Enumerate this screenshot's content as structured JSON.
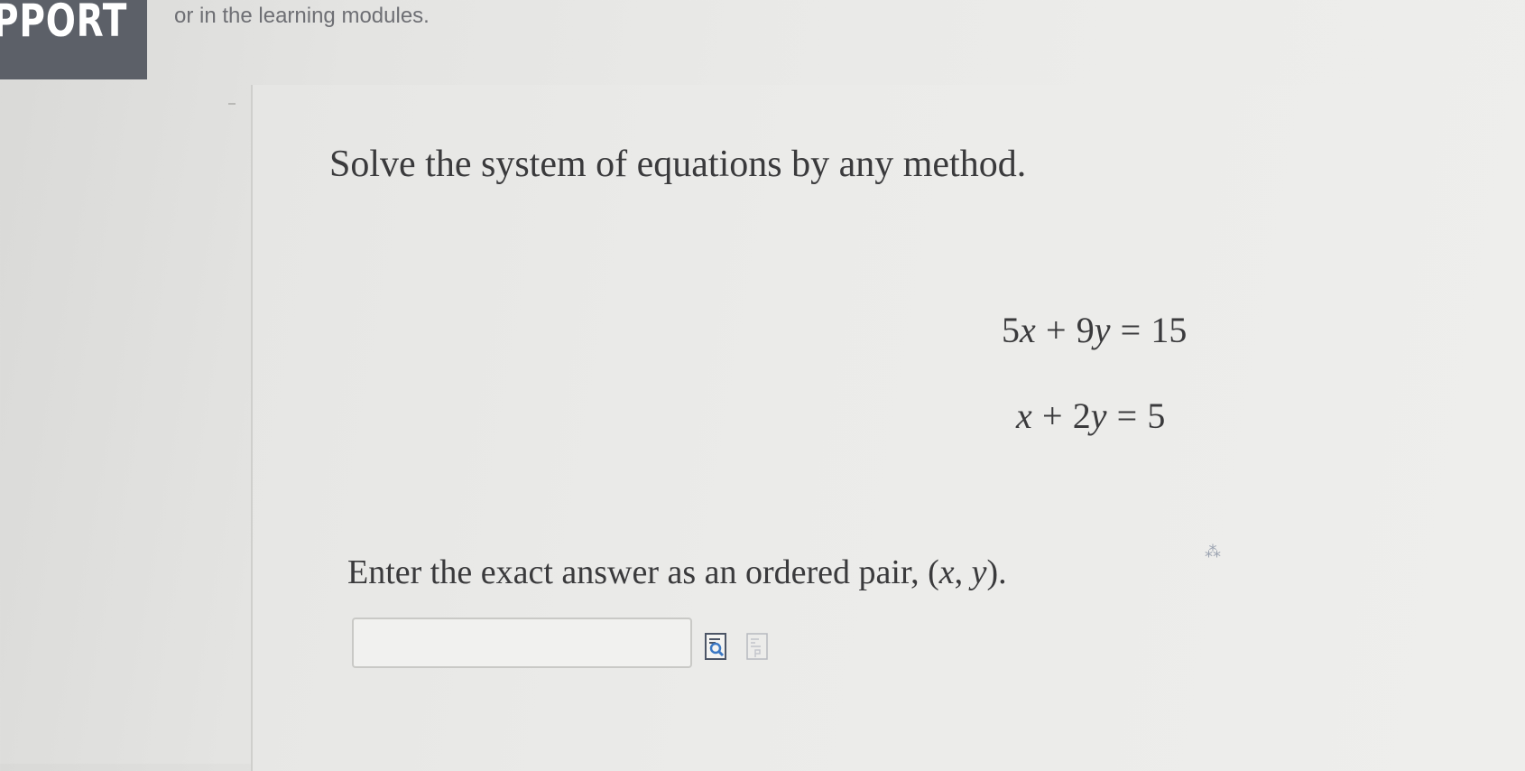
{
  "banner": {
    "text": "PPORT"
  },
  "header": {
    "note": "or in the learning modules."
  },
  "question": {
    "prompt": "Solve the system of equations by any method.",
    "equations": [
      "5x + 9y = 15",
      "x + 2y = 5"
    ],
    "instruction_prefix": "Enter the exact answer as an ordered pair, ",
    "instruction_math": "(x, y)",
    "instruction_suffix": "."
  },
  "answer": {
    "value": "",
    "placeholder": ""
  },
  "icons": [
    "preview-icon",
    "equation-editor-icon"
  ]
}
